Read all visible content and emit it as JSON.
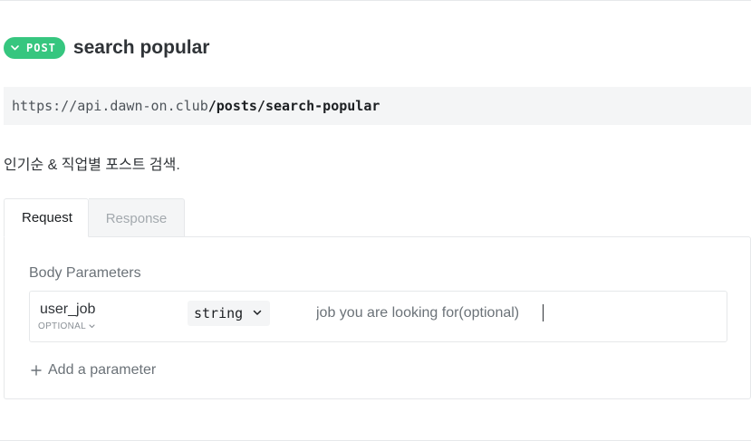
{
  "endpoint": {
    "method": "POST",
    "title": "search popular",
    "url_base": "https://api.dawn-on.club",
    "url_path": "/posts/search-popular",
    "description": "인기순 & 직업별 포스트 검색."
  },
  "tabs": [
    {
      "label": "Request",
      "active": true
    },
    {
      "label": "Response",
      "active": false
    }
  ],
  "request": {
    "section_label": "Body Parameters",
    "params": [
      {
        "name": "user_job",
        "optional_label": "OPTIONAL",
        "type": "string",
        "placeholder": "job you are looking for(optional)",
        "value": ""
      }
    ],
    "add_label": "Add a parameter"
  },
  "colors": {
    "method_badge": "#36c67f",
    "url_bar_bg": "#f4f5f6",
    "border": "#e6e8ea",
    "muted_text": "#6b7278"
  },
  "icons": {
    "badge": "chevron-down-icon",
    "optional": "chevron-down-icon",
    "type_select": "chevron-down-icon",
    "add": "plus-icon"
  }
}
